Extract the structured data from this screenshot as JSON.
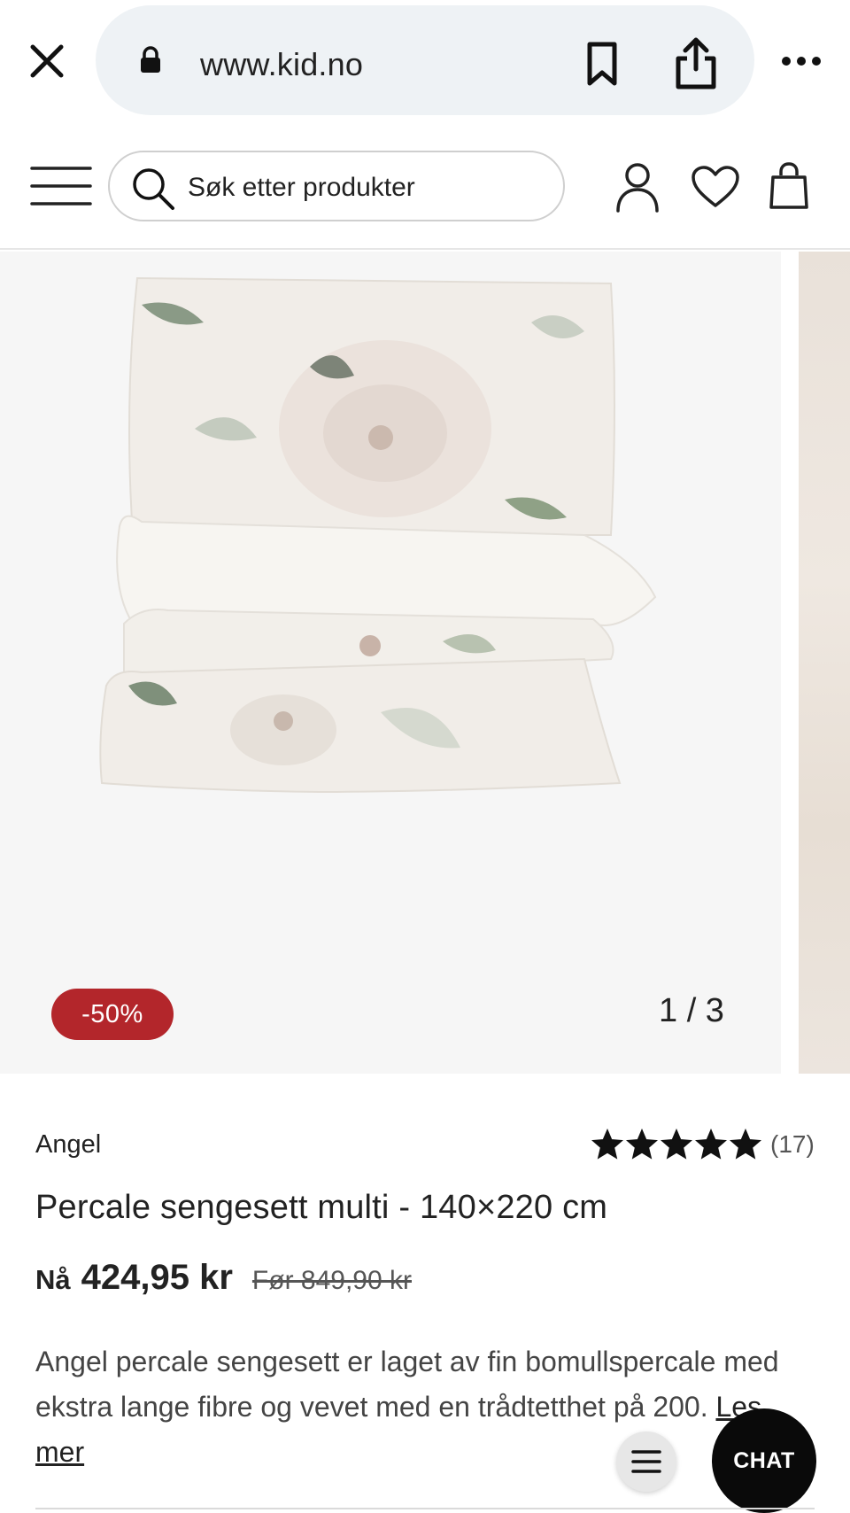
{
  "browser": {
    "url": "www.kid.no"
  },
  "header": {
    "search_placeholder": "Søk etter produkter"
  },
  "gallery": {
    "discount": "-50%",
    "counter": "1 / 3"
  },
  "product": {
    "brand": "Angel",
    "rating_stars": 5,
    "review_count": "(17)",
    "title": "Percale sengesett multi - 140×220 cm",
    "price_prefix": "Nå",
    "price_now": "424,95 kr",
    "price_before": "Før 849,90 kr",
    "description": "Angel percale sengesett er laget av fin bomullspercale med ekstra lange fibre og vevet med en trådtetthet på 200. ",
    "read_more": "Les mer"
  },
  "floating": {
    "chat_label": "CHAT"
  },
  "colors": {
    "discount_badge": "#b3262b",
    "chat_button": "#0a0a0a",
    "url_bar": "#eef2f5"
  },
  "icons": [
    "close-icon",
    "lock-icon",
    "bookmark-icon",
    "share-icon",
    "more-icon",
    "hamburger-icon",
    "search-icon",
    "user-icon",
    "heart-icon",
    "bag-icon",
    "star-icon",
    "list-icon"
  ]
}
